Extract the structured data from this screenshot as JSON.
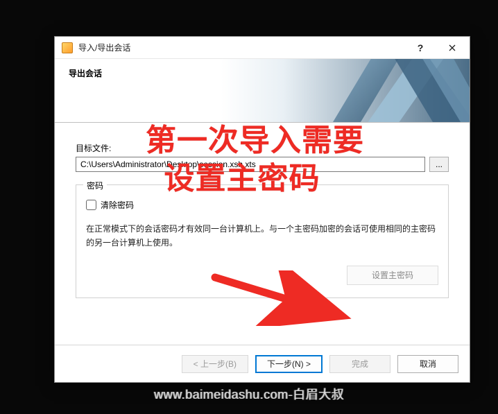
{
  "window": {
    "title": "导入/导出会话"
  },
  "header": {
    "title": "导出会话"
  },
  "target": {
    "label": "目标文件:",
    "path": "C:\\Users\\Administrator\\Desktop\\session.xsh.xts",
    "browse": "..."
  },
  "password_group": {
    "legend": "密码",
    "clear_pw_label": "清除密码",
    "note": "在正常模式下的会话密码才有效同一台计算机上。与一个主密码加密的会话可使用相同的主密码的另一台计算机上使用。",
    "set_master_btn": "设置主密码"
  },
  "footer": {
    "back": "< 上一步(B)",
    "next": "下一步(N) >",
    "finish": "完成",
    "cancel": "取消"
  },
  "annotation": {
    "line1": "第一次导入需要",
    "line2": "设置主密码"
  },
  "watermark": "www.baimeidashu.com-白眉大叔"
}
